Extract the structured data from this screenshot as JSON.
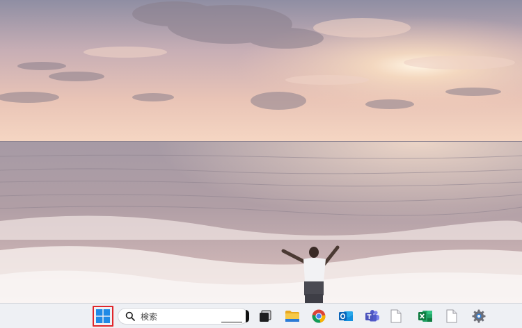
{
  "taskbar": {
    "search_placeholder": "検索",
    "apps": [
      {
        "name": "start",
        "icon": "windows-logo-icon"
      },
      {
        "name": "task-view",
        "icon": "task-view-icon"
      },
      {
        "name": "file-explorer",
        "icon": "folder-icon"
      },
      {
        "name": "chrome",
        "icon": "chrome-icon"
      },
      {
        "name": "outlook",
        "icon": "outlook-icon"
      },
      {
        "name": "teams",
        "icon": "teams-icon"
      },
      {
        "name": "file",
        "icon": "document-icon"
      },
      {
        "name": "excel",
        "icon": "excel-icon"
      },
      {
        "name": "file-2",
        "icon": "document-icon"
      },
      {
        "name": "settings",
        "icon": "gear-icon"
      }
    ],
    "start_highlight_color": "#e0262a"
  }
}
